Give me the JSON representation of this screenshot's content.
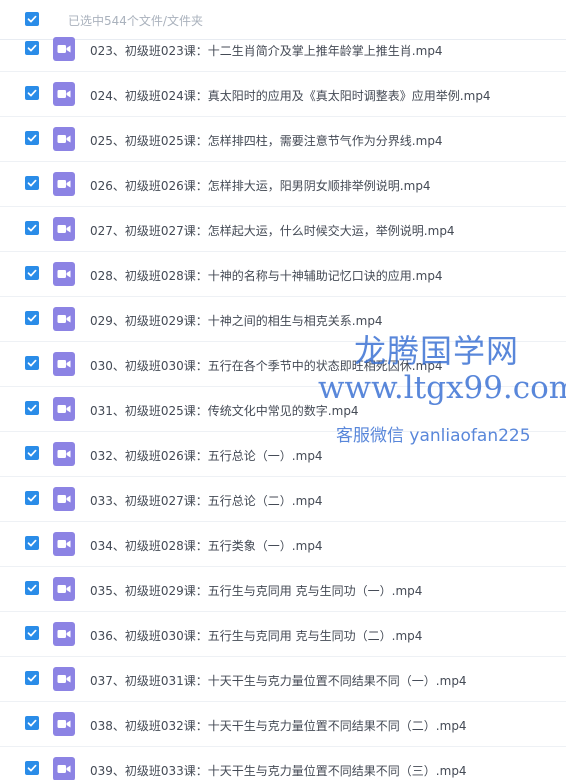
{
  "header": {
    "selection_text": "已选中544个文件/文件夹"
  },
  "colors": {
    "checkbox": "#2a8ce8",
    "video_icon": "#8c83e4",
    "watermark": "#346cd2"
  },
  "icons": {
    "checkbox": "checkmark-icon",
    "file": "video-file-icon"
  },
  "files": [
    {
      "name": "023、初级班023课：十二生肖简介及掌上推年龄掌上推生肖.mp4",
      "checked": true
    },
    {
      "name": "024、初级班024课：真太阳时的应用及《真太阳时调整表》应用举例.mp4",
      "checked": true
    },
    {
      "name": "025、初级班025课：怎样排四柱，需要注意节气作为分界线.mp4",
      "checked": true
    },
    {
      "name": "026、初级班026课：怎样排大运，阳男阴女顺排举例说明.mp4",
      "checked": true
    },
    {
      "name": "027、初级班027课：怎样起大运，什么时候交大运，举例说明.mp4",
      "checked": true
    },
    {
      "name": "028、初级班028课：十神的名称与十神辅助记忆口诀的应用.mp4",
      "checked": true
    },
    {
      "name": "029、初级班029课：十神之间的相生与相克关系.mp4",
      "checked": true
    },
    {
      "name": "030、初级班030课：五行在各个季节中的状态即旺相死囚休.mp4",
      "checked": true
    },
    {
      "name": "031、初级班025课：传统文化中常见的数字.mp4",
      "checked": true
    },
    {
      "name": "032、初级班026课：五行总论（一）.mp4",
      "checked": true
    },
    {
      "name": "033、初级班027课：五行总论（二）.mp4",
      "checked": true
    },
    {
      "name": "034、初级班028课：五行类象（一）.mp4",
      "checked": true
    },
    {
      "name": "035、初级班029课：五行生与克同用 克与生同功（一）.mp4",
      "checked": true
    },
    {
      "name": "036、初级班030课：五行生与克同用 克与生同功（二）.mp4",
      "checked": true
    },
    {
      "name": "037、初级班031课：十天干生与克力量位置不同结果不同（一）.mp4",
      "checked": true
    },
    {
      "name": "038、初级班032课：十天干生与克力量位置不同结果不同（二）.mp4",
      "checked": true
    },
    {
      "name": "039、初级班033课：十天干生与克力量位置不同结果不同（三）.mp4",
      "checked": true
    }
  ],
  "watermark": {
    "line1": "龙腾国学网",
    "line2": "www.ltgx99.com",
    "line3": "客服微信 yanliaofan225"
  }
}
